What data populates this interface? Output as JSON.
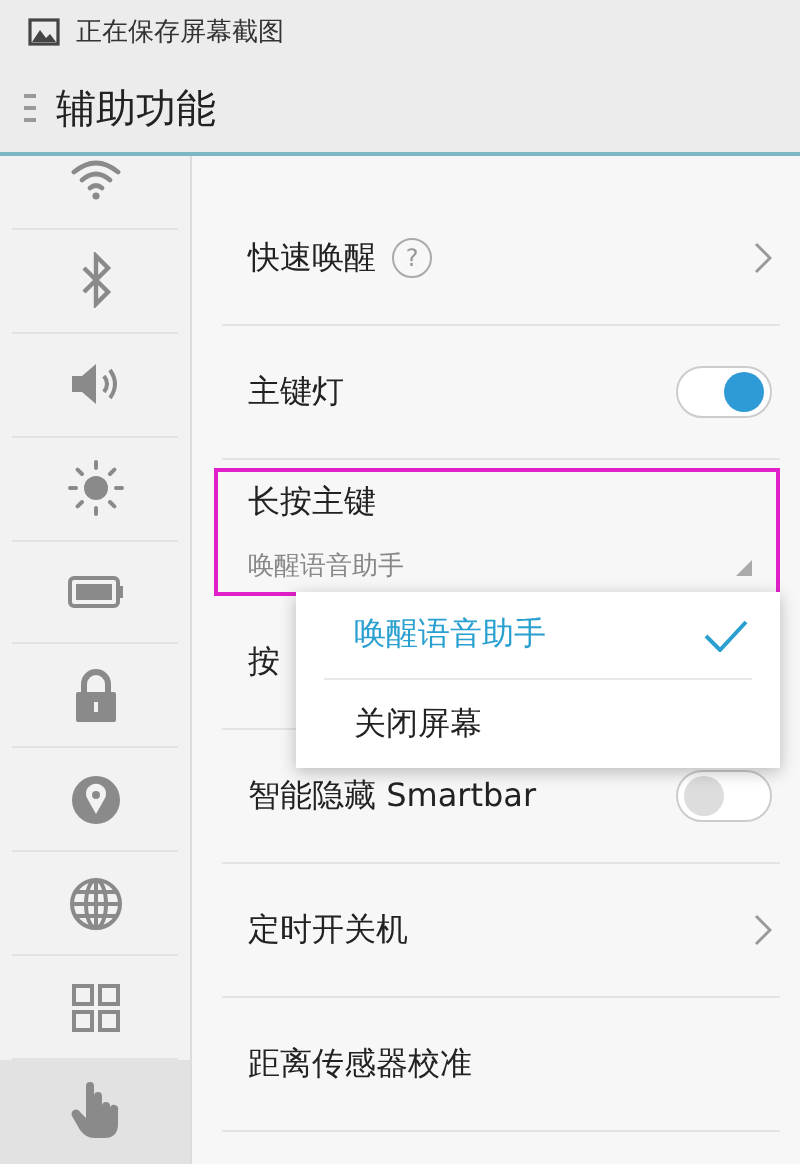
{
  "status_bar": {
    "notification": "正在保存屏幕截图"
  },
  "header": {
    "title": "辅助功能"
  },
  "sidebar": {
    "items": [
      {
        "kind": "wifi",
        "selected": false
      },
      {
        "kind": "bluetooth",
        "selected": false
      },
      {
        "kind": "sound",
        "selected": false
      },
      {
        "kind": "brightness",
        "selected": false
      },
      {
        "kind": "battery",
        "selected": false
      },
      {
        "kind": "lock",
        "selected": false
      },
      {
        "kind": "location",
        "selected": false
      },
      {
        "kind": "globe",
        "selected": false
      },
      {
        "kind": "apps",
        "selected": false
      },
      {
        "kind": "hand",
        "selected": true
      }
    ]
  },
  "settings": [
    {
      "kind": "link",
      "label": "快速唤醒",
      "help": "?"
    },
    {
      "kind": "toggle",
      "label": "主键灯",
      "on": true
    },
    {
      "kind": "dropdown",
      "label": "长按主键",
      "value": "唤醒语音助手",
      "highlighted": true
    },
    {
      "kind": "plain",
      "label": "按"
    },
    {
      "kind": "toggle",
      "label": "智能隐藏 Smartbar",
      "on": false
    },
    {
      "kind": "link",
      "label": "定时开关机"
    },
    {
      "kind": "plain",
      "label": "距离传感器校准"
    }
  ],
  "popup": {
    "options": [
      {
        "label": "唤醒语音助手",
        "selected": true
      },
      {
        "label": "关闭屏幕",
        "selected": false
      }
    ]
  }
}
